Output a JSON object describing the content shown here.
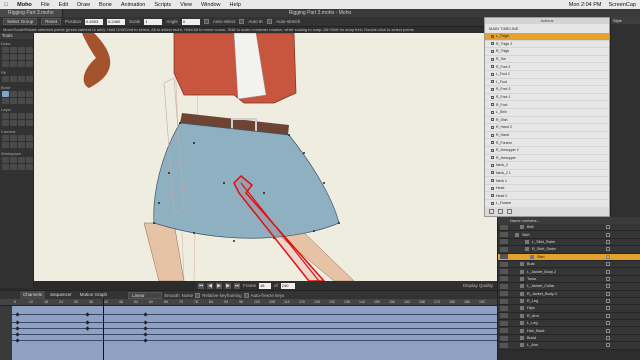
{
  "menubar": {
    "app_icon": "apple-icon",
    "items": [
      "Moho",
      "File",
      "Edit",
      "Draw",
      "Bone",
      "Animation",
      "Scripts",
      "View",
      "Window",
      "Help"
    ],
    "clock": "Mon 2:04 PM",
    "screencap": "ScreenCap"
  },
  "window": {
    "tab": "Rigging Part 3.moho",
    "title": "Rigging Part 3.moho - Moho"
  },
  "tool_options": {
    "select_group": "Select Group",
    "reset": "Reset",
    "position_label": "Position",
    "position_x": "0.4003",
    "position_y": "0.2460",
    "scale_label": "Scale",
    "scale_value": "1",
    "angle_label": "Angle",
    "angle_value": "0",
    "auto_select": "Auto-select",
    "auto_ik": "Auto IK",
    "auto_stretch": "Auto-stretch"
  },
  "status_text": "Move/Scale/Rotate selected points (press camera to add). Hold Cntl/Cmd to select, Alt to select more, Hold Alt to move cursor, Shift to scale constrain rotation, while scaling to snap; Alt+Shift for snap free; Double-click to select points",
  "tools_panel": {
    "header": "Tools",
    "groups": [
      "Draw",
      "Fill",
      "Bone",
      "Layer",
      "Camera",
      "Workspace"
    ]
  },
  "canvas_footer": {
    "frame_label": "Frame",
    "frame_value": "18",
    "of_label": "of",
    "total_frames": "240",
    "display_quality": "Display Quality"
  },
  "timeline": {
    "tabs": [
      "Channels",
      "Sequencer",
      "Motion Graph"
    ],
    "interp": "Linear",
    "smooth": "Smooth",
    "noise": "Noise",
    "relative_keyframing": "Relative keyframing",
    "auto_freeze": "Auto-freeze keys",
    "ruler_marks": [
      "6",
      "12",
      "18",
      "24",
      "30",
      "36",
      "42",
      "48",
      "54",
      "60",
      "66",
      "72",
      "78",
      "84",
      "90",
      "96",
      "102",
      "108",
      "114",
      "120",
      "126",
      "132",
      "138",
      "144",
      "150",
      "156",
      "162",
      "168",
      "174",
      "180",
      "186",
      "192"
    ]
  },
  "actions_panel": {
    "title": "Actions",
    "sub_label": "MAIN TIMELINE",
    "items": [
      "L_Thigh",
      "R_Thigh 2",
      "R_Thigh",
      "R_Toe",
      "R_Foot 2",
      "L_Foot 2",
      "L_Foot",
      "R_Foot 3",
      "R_Foot 1",
      "R_Foot",
      "L_Shin",
      "R_Shin",
      "R_Hand 2",
      "R_Hand",
      "R_Forarm",
      "R_Armupper 2",
      "R_Armupper",
      "Neck_2",
      "Neck_2 1",
      "Neck 1",
      "Head",
      "Head 2",
      "L_Forarm",
      "L_Hand"
    ],
    "selected_index": 0
  },
  "right_panel": {
    "header": "Style"
  },
  "layers_panel": {
    "header": "Name contains...",
    "rows": [
      {
        "name": "Belt",
        "indent": 2
      },
      {
        "name": "Skirt",
        "indent": 1
      },
      {
        "name": "L_Skirt_Swim",
        "indent": 3
      },
      {
        "name": "R_Skirt_Swim",
        "indent": 3
      },
      {
        "name": "Skirt",
        "indent": 4
      },
      {
        "name": "Bust",
        "indent": 2
      },
      {
        "name": "L_Jacket_Body 2",
        "indent": 2
      },
      {
        "name": "Torso",
        "indent": 2
      },
      {
        "name": "L_Jacket_Collar",
        "indent": 2
      },
      {
        "name": "R_Jacket_Body 4",
        "indent": 2
      },
      {
        "name": "R_Leg",
        "indent": 2
      },
      {
        "name": "Hips",
        "indent": 2
      },
      {
        "name": "R_Arm",
        "indent": 2
      },
      {
        "name": "L_Leg",
        "indent": 2
      },
      {
        "name": "Hair_Back",
        "indent": 2
      },
      {
        "name": "Braid",
        "indent": 2
      },
      {
        "name": "L_Arm",
        "indent": 2
      }
    ],
    "selected_index": 4
  },
  "colors": {
    "canvas_bg": "#efece0",
    "selection": "#e3a230",
    "jacket": "#c8553d",
    "skirt": "#7fa3b4",
    "bone_red": "#e01010"
  }
}
